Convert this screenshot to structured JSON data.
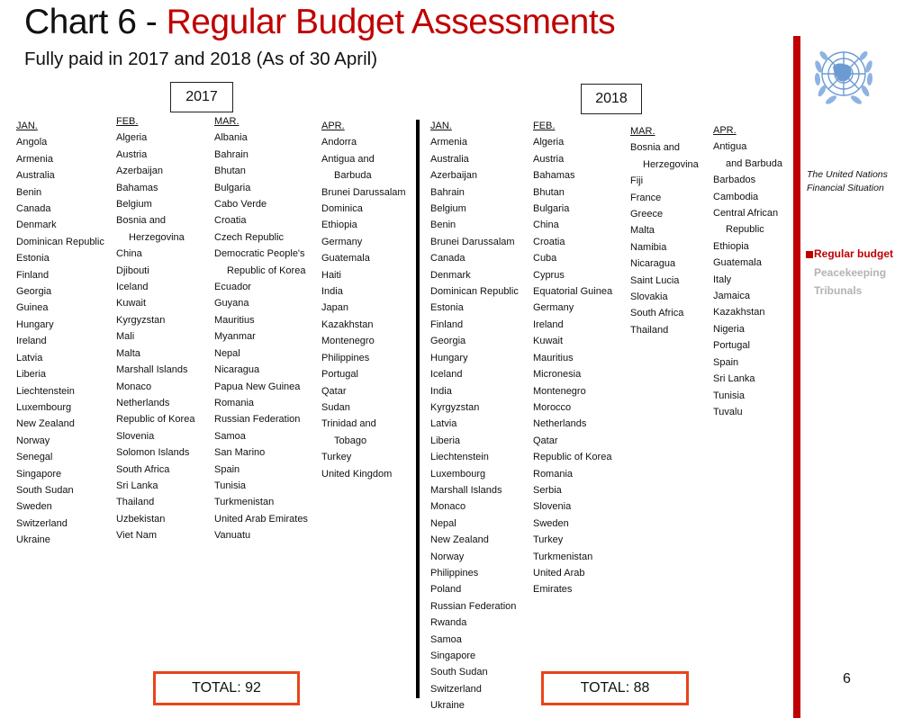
{
  "header": {
    "title_prefix": "Chart 6 - ",
    "title_main": "Regular Budget Assessments",
    "subtitle": "Fully paid in 2017 and 2018 (As of 30 April)"
  },
  "colors": {
    "accent_red": "#c00000",
    "total_border": "#e8451a",
    "inactive_gray": "#b3b3b3"
  },
  "year2017": {
    "label": "2017",
    "total": "TOTAL: 92",
    "months": [
      {
        "header": "JAN.",
        "items": [
          "Angola",
          "Armenia",
          "Australia",
          "Benin",
          "Canada",
          "Denmark",
          "Dominican Republic",
          "Estonia",
          "Finland",
          "Georgia",
          "Guinea",
          "Hungary",
          "Ireland",
          "Latvia",
          "Liberia",
          "Liechtenstein",
          "Luxembourg",
          "New Zealand",
          "Norway",
          "Senegal",
          "Singapore",
          "South Sudan",
          "Sweden",
          "Switzerland",
          "Ukraine"
        ]
      },
      {
        "header": "FEB.",
        "items": [
          "Algeria",
          "Austria",
          "Azerbaijan",
          "Bahamas",
          "Belgium",
          "Bosnia and",
          "Herzegovina",
          "China",
          "Djibouti",
          "Iceland",
          "Kuwait",
          "Kyrgyzstan",
          "Mali",
          "Malta",
          "Marshall Islands",
          "Monaco",
          "Netherlands",
          "Republic of Korea",
          "Slovenia",
          "Solomon Islands",
          "South Africa",
          "Sri Lanka",
          "Thailand",
          "Uzbekistan",
          "Viet Nam"
        ]
      },
      {
        "header": "MAR.",
        "items": [
          "Albania",
          "Bahrain",
          "Bhutan",
          "Bulgaria",
          "Cabo Verde",
          "Croatia",
          "Czech Republic",
          "Democratic  People's",
          "Republic of Korea",
          "Ecuador",
          "Guyana",
          "Mauritius",
          "Myanmar",
          "Nepal",
          "Nicaragua",
          "Papua New Guinea",
          "Romania",
          "Russian Federation",
          "Samoa",
          "San Marino",
          "Spain",
          "Tunisia",
          "Turkmenistan",
          "United Arab Emirates",
          "Vanuatu"
        ]
      },
      {
        "header": "APR.",
        "items": [
          "Andorra",
          "Antigua and",
          "Barbuda",
          "Brunei Darussalam",
          "Dominica",
          "Ethiopia",
          "Germany",
          "Guatemala",
          "Haiti",
          "India",
          "Japan",
          "Kazakhstan",
          "Montenegro",
          "Philippines",
          "Portugal",
          "Qatar",
          "Sudan",
          "Trinidad and",
          "Tobago",
          "Turkey",
          "United Kingdom"
        ]
      }
    ]
  },
  "year2018": {
    "label": "2018",
    "total": "TOTAL: 88",
    "months": [
      {
        "header": "JAN.",
        "items": [
          "Armenia",
          "Australia",
          "Azerbaijan",
          "Bahrain",
          "Belgium",
          "Benin",
          "Brunei Darussalam",
          "Canada",
          "Denmark",
          "Dominican Republic",
          "Estonia",
          "Finland",
          "Georgia",
          "Hungary",
          "Iceland",
          "India",
          "Kyrgyzstan",
          "Latvia",
          "Liberia",
          "Liechtenstein",
          "Luxembourg",
          "Marshall Islands",
          "Monaco",
          "Nepal",
          "New Zealand",
          "Norway",
          "Philippines",
          "Poland",
          "Russian Federation",
          "Rwanda",
          "Samoa",
          "Singapore",
          "South Sudan",
          "Switzerland",
          "Ukraine"
        ]
      },
      {
        "header": "FEB.",
        "items": [
          "Algeria",
          "Austria",
          "Bahamas",
          "Bhutan",
          "Bulgaria",
          "China",
          "Croatia",
          "Cuba",
          "Cyprus",
          "Equatorial Guinea",
          "Germany",
          "Ireland",
          "Kuwait",
          "Mauritius",
          "Micronesia",
          "Montenegro",
          "Morocco",
          "Netherlands",
          "Qatar",
          "Republic of Korea",
          "Romania",
          "Serbia",
          "Slovenia",
          "Sweden",
          "Turkey",
          "Turkmenistan",
          "United Arab",
          "Emirates"
        ]
      },
      {
        "header": "MAR.",
        "items": [
          "Bosnia and",
          "Herzegovina",
          "Fiji",
          "France",
          "Greece",
          "Malta",
          "Namibia",
          "Nicaragua",
          "Saint Lucia",
          "Slovakia",
          "South Africa",
          "Thailand"
        ]
      },
      {
        "header": "APR.",
        "items": [
          "Antigua",
          "and Barbuda",
          "Barbados",
          "Cambodia",
          "Central African",
          "Republic",
          "Ethiopia",
          "Guatemala",
          "Italy",
          "Jamaica",
          "Kazakhstan",
          "Nigeria",
          "Portugal",
          "Spain",
          "Sri Lanka",
          "Tunisia",
          "Tuvalu"
        ]
      }
    ]
  },
  "sidebar": {
    "logo": "un-emblem-icon",
    "caption_line1": "The United Nations",
    "caption_line2": "Financial Situation",
    "menu": [
      {
        "label": "Regular budget",
        "active": true
      },
      {
        "label": "Peacekeeping",
        "active": false
      },
      {
        "label": "Tribunals",
        "active": false
      }
    ]
  },
  "page_number": "6"
}
